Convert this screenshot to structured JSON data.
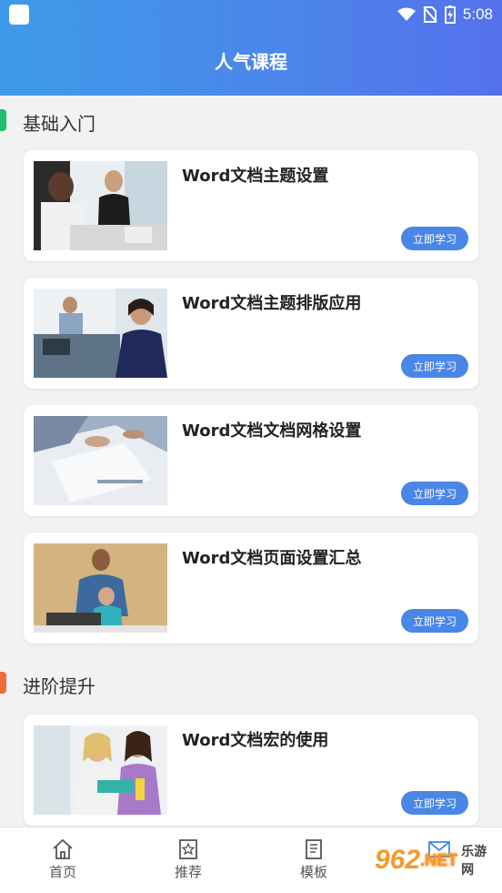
{
  "status_bar": {
    "time": "5:08"
  },
  "header": {
    "title": "人气课程"
  },
  "sections": [
    {
      "title": "基础入门",
      "accent": "#1fbe6b",
      "courses": [
        {
          "title": "Word文档主题设置",
          "button": "立即学习",
          "image": "office-meeting-image"
        },
        {
          "title": "Word文档主题排版应用",
          "button": "立即学习",
          "image": "office-woman-image"
        },
        {
          "title": "Word文档文档网格设置",
          "button": "立即学习",
          "image": "documents-image"
        },
        {
          "title": "Word文档页面设置汇总",
          "button": "立即学习",
          "image": "teacher-student-image"
        }
      ]
    },
    {
      "title": "进阶提升",
      "accent": "#ef6a3d",
      "courses": [
        {
          "title": "Word文档宏的使用",
          "button": "立即学习",
          "image": "students-image"
        }
      ]
    }
  ],
  "tabbar": {
    "items": [
      {
        "label": "首页",
        "icon": "home-icon"
      },
      {
        "label": "推荐",
        "icon": "star-bookmark-icon"
      },
      {
        "label": "模板",
        "icon": "template-book-icon"
      },
      {
        "label": "",
        "icon": "mail-icon"
      }
    ]
  },
  "watermark": {
    "main": "962",
    "suffix": ".NET",
    "sub": "乐游网"
  }
}
